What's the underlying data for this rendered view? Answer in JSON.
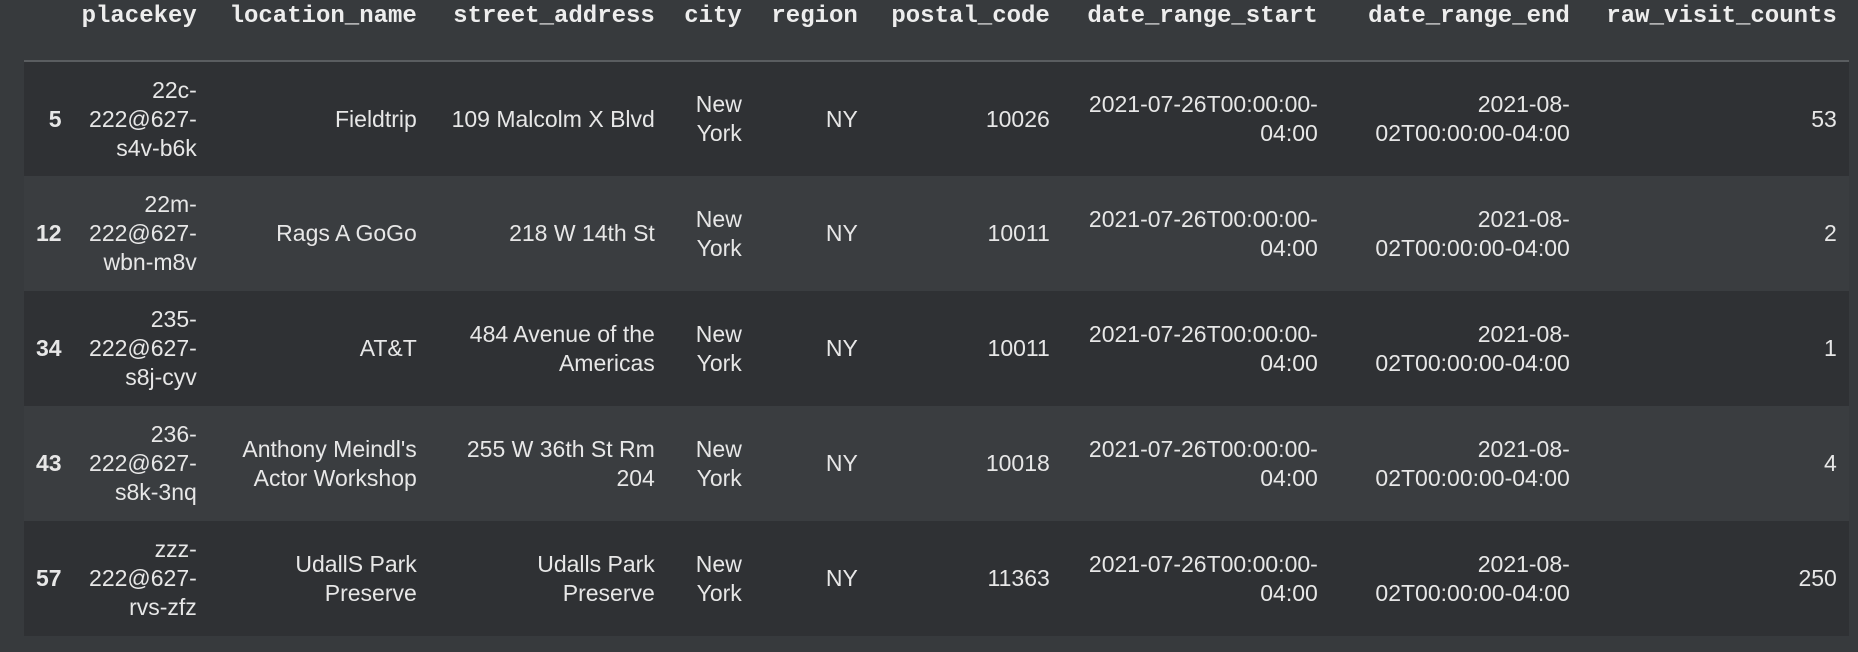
{
  "columns": [
    "placekey",
    "location_name",
    "street_address",
    "city",
    "region",
    "postal_code",
    "date_range_start",
    "date_range_end",
    "raw_visit_counts"
  ],
  "rows": [
    {
      "index": "5",
      "placekey": "22c-222@627-s4v-b6k",
      "location_name": "Fieldtrip",
      "street_address": "109 Malcolm X Blvd",
      "city": "New York",
      "region": "NY",
      "postal_code": "10026",
      "date_range_start": "2021-07-26T00:00:00-04:00",
      "date_range_end": "2021-08-02T00:00:00-04:00",
      "raw_visit_counts": "53"
    },
    {
      "index": "12",
      "placekey": "22m-222@627-wbn-m8v",
      "location_name": "Rags A GoGo",
      "street_address": "218 W 14th St",
      "city": "New York",
      "region": "NY",
      "postal_code": "10011",
      "date_range_start": "2021-07-26T00:00:00-04:00",
      "date_range_end": "2021-08-02T00:00:00-04:00",
      "raw_visit_counts": "2"
    },
    {
      "index": "34",
      "placekey": "235-222@627-s8j-cyv",
      "location_name": "AT&T",
      "street_address": "484 Avenue of the Americas",
      "city": "New York",
      "region": "NY",
      "postal_code": "10011",
      "date_range_start": "2021-07-26T00:00:00-04:00",
      "date_range_end": "2021-08-02T00:00:00-04:00",
      "raw_visit_counts": "1"
    },
    {
      "index": "43",
      "placekey": "236-222@627-s8k-3nq",
      "location_name": "Anthony Meindl's Actor Workshop",
      "street_address": "255 W 36th St Rm 204",
      "city": "New York",
      "region": "NY",
      "postal_code": "10018",
      "date_range_start": "2021-07-26T00:00:00-04:00",
      "date_range_end": "2021-08-02T00:00:00-04:00",
      "raw_visit_counts": "4"
    },
    {
      "index": "57",
      "placekey": "zzz-222@627-rvs-zfz",
      "location_name": "UdallS Park Preserve",
      "street_address": "Udalls Park Preserve",
      "city": "New York",
      "region": "NY",
      "postal_code": "11363",
      "date_range_start": "2021-07-26T00:00:00-04:00",
      "date_range_end": "2021-08-02T00:00:00-04:00",
      "raw_visit_counts": "250"
    }
  ]
}
